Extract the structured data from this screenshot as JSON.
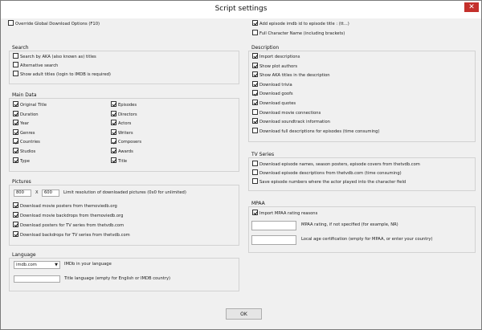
{
  "window": {
    "title": "Script settings",
    "close_label": "✕"
  },
  "override": {
    "label": "Override Global Download Options (F10)",
    "checked": false
  },
  "top_right": [
    {
      "label": "Add episode imdb id to episode title : (tt...)",
      "checked": true
    },
    {
      "label": "Full Character Name (including brackets)",
      "checked": false
    }
  ],
  "search": {
    "title": "Search",
    "items": [
      {
        "label": "Search by AKA (also known as) titles",
        "checked": false
      },
      {
        "label": "Alternative search",
        "checked": false
      },
      {
        "label": "Show adult titles (login to IMDB is required)",
        "checked": false
      }
    ]
  },
  "main_data": {
    "title": "Main Data",
    "col1": [
      {
        "label": "Original Title",
        "checked": true
      },
      {
        "label": "Duration",
        "checked": true
      },
      {
        "label": "Year",
        "checked": true
      },
      {
        "label": "Genres",
        "checked": true
      },
      {
        "label": "Countries",
        "checked": true
      },
      {
        "label": "Studios",
        "checked": true
      },
      {
        "label": "Type",
        "checked": true
      }
    ],
    "col2": [
      {
        "label": "Episodes",
        "checked": true
      },
      {
        "label": "Directors",
        "checked": true
      },
      {
        "label": "Actors",
        "checked": true
      },
      {
        "label": "Writers",
        "checked": true
      },
      {
        "label": "Composers",
        "checked": true
      },
      {
        "label": "Awards",
        "checked": true
      },
      {
        "label": "Title",
        "checked": true
      }
    ]
  },
  "pictures": {
    "title": "Pictures",
    "width_value": "800",
    "x_label": "X",
    "height_value": "600",
    "limit_label": "Limit resolution of downloaded pictures (0x0 for unlimited)",
    "items": [
      {
        "label": "Download movie posters from themoviedb.org",
        "checked": true
      },
      {
        "label": "Download movie backdrops from themoviedb.org",
        "checked": true
      },
      {
        "label": "Download posters for TV series from thetvdb.com",
        "checked": true
      },
      {
        "label": "Download backdrops for TV series from thetvdb.com",
        "checked": true
      }
    ]
  },
  "language": {
    "title": "Language",
    "select_value": "imdb.com",
    "select_label": "IMDb in your language",
    "title_lang_value": "",
    "title_lang_label": "Title language (empty for English or IMDB country)"
  },
  "description": {
    "title": "Description",
    "items": [
      {
        "label": "Import descriptions",
        "checked": true
      },
      {
        "label": "Show plot authors",
        "checked": true
      },
      {
        "label": "Show AKA titles in the description",
        "checked": true
      },
      {
        "label": "Download trivia",
        "checked": true
      },
      {
        "label": "Download goofs",
        "checked": true
      },
      {
        "label": "Download quotes",
        "checked": true
      },
      {
        "label": "Download movie connections",
        "checked": false
      },
      {
        "label": "Download soundtrack information",
        "checked": true
      },
      {
        "label": "Download full descriptions for episodes (time consuming)",
        "checked": false
      }
    ]
  },
  "tv_series": {
    "title": "TV Series",
    "items": [
      {
        "label": "Download episode names, season posters, episode covers from thetvdb.com",
        "checked": false
      },
      {
        "label": "Download episode descriptions from thetvdb.com (time consuming)",
        "checked": false
      },
      {
        "label": "Save episode numbers where the actor played into the character field",
        "checked": false
      }
    ]
  },
  "mpaa": {
    "title": "MPAA",
    "import_label": "Import MPAA rating reasons",
    "import_checked": true,
    "rating_value": "",
    "rating_label": "MPAA rating, if not specified (for example, NR)",
    "local_value": "",
    "local_label": "Local age certification (empty for MPAA, or enter your country)"
  },
  "ok_label": "OK"
}
